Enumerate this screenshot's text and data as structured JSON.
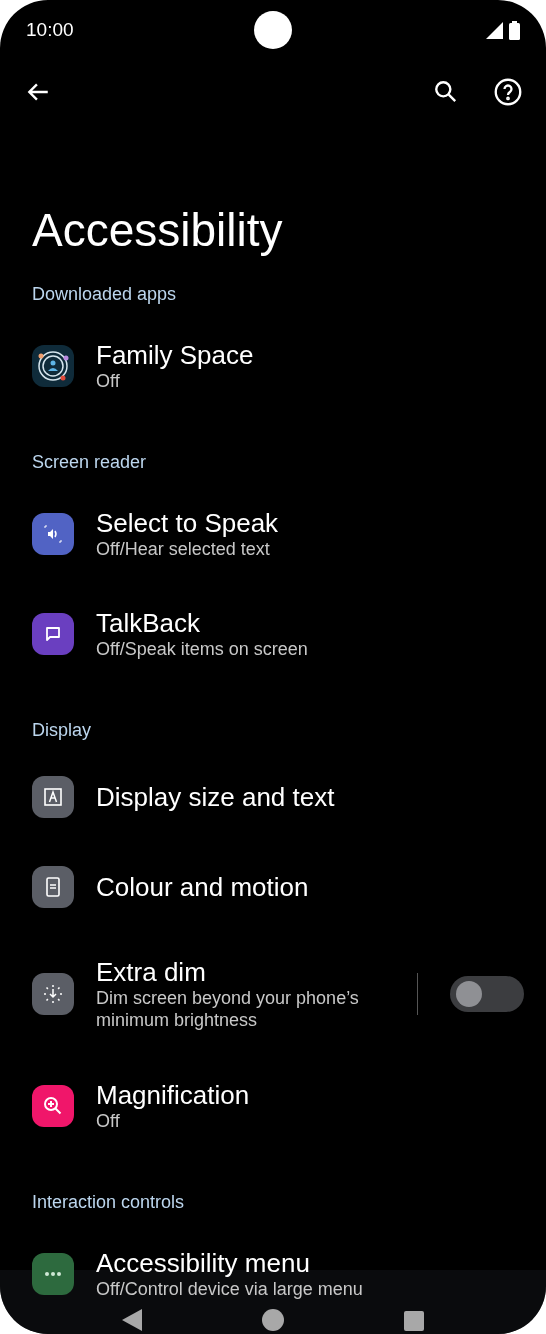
{
  "status_bar": {
    "time": "10:00"
  },
  "title": "Accessibility",
  "sections": [
    {
      "header": "Downloaded apps",
      "items": [
        {
          "kind": "plain",
          "title": "Family Space",
          "subtitle": "Off"
        }
      ]
    },
    {
      "header": "Screen reader",
      "items": [
        {
          "kind": "plain",
          "title": "Select to Speak",
          "subtitle": "Off/Hear selected text"
        },
        {
          "kind": "plain",
          "title": "TalkBack",
          "subtitle": "Off/Speak items on screen"
        }
      ]
    },
    {
      "header": "Display",
      "items": [
        {
          "kind": "plain",
          "title": "Display size and text"
        },
        {
          "kind": "plain",
          "title": "Colour and motion"
        },
        {
          "kind": "toggle",
          "title": "Extra dim",
          "subtitle": "Dim screen beyond your phone’s minimum brightness",
          "on": false
        },
        {
          "kind": "plain",
          "title": "Magnification",
          "subtitle": "Off"
        }
      ]
    },
    {
      "header": "Interaction controls",
      "items": [
        {
          "kind": "plain",
          "title": "Accessibility menu",
          "subtitle": "Off/Control device via large menu"
        }
      ]
    }
  ]
}
